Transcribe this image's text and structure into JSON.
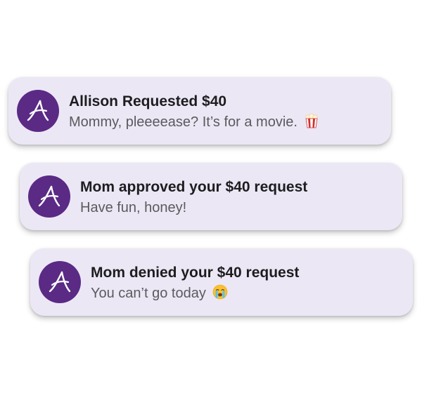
{
  "colors": {
    "card_background": "#ece7f5",
    "avatar_background": "#5a2a85",
    "title_text": "#1d1d1f",
    "body_text": "#5a5a5e"
  },
  "notifications": [
    {
      "avatar_icon": "app-logo-a-icon",
      "title": "Allison Requested $40",
      "message": "Mommy, pleeeease? It’s for a movie.",
      "emoji_icon": "popcorn-icon"
    },
    {
      "avatar_icon": "app-logo-a-icon",
      "title": "Mom approved your $40 request",
      "message": "Have fun, honey!",
      "emoji_icon": ""
    },
    {
      "avatar_icon": "app-logo-a-icon",
      "title": "Mom denied your $40 request",
      "message": "You can’t go today",
      "emoji_icon": "crying-face-icon"
    }
  ]
}
